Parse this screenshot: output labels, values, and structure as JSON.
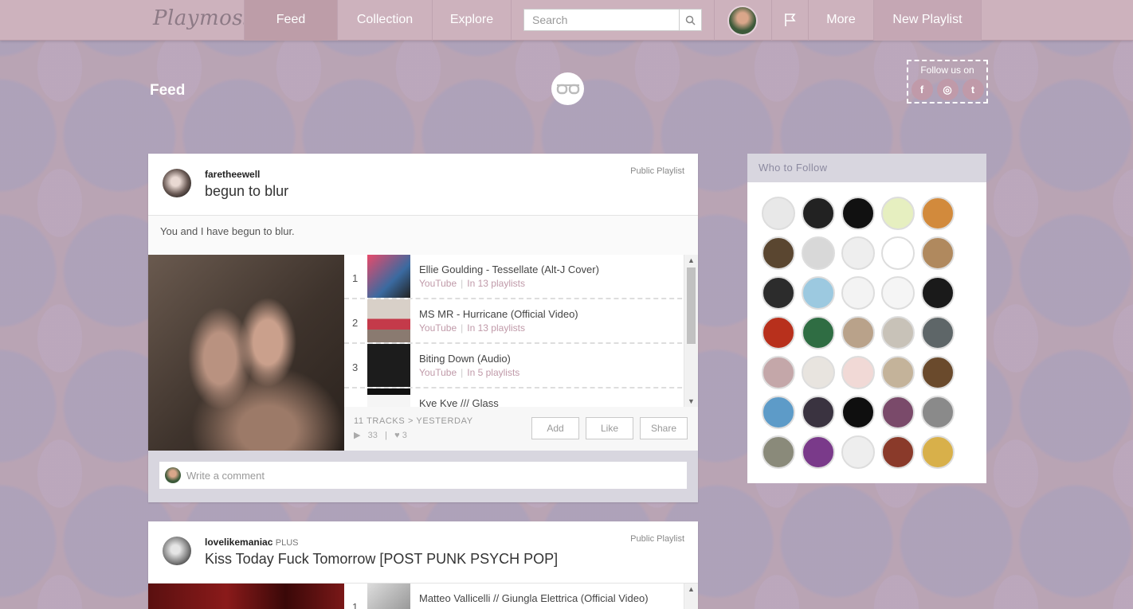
{
  "nav": {
    "logo": "Playmoss",
    "items": [
      "Feed",
      "Collection",
      "Explore"
    ],
    "search_placeholder": "Search",
    "more": "More",
    "new_playlist": "New Playlist"
  },
  "header": {
    "title": "Feed",
    "follow_label": "Follow us on",
    "socials": [
      "f",
      "◎",
      "t"
    ]
  },
  "posts": [
    {
      "username": "faretheewell",
      "badge": "",
      "visibility": "Public Playlist",
      "title": "begun to blur",
      "description": "You and I have begun to blur.",
      "tracks": [
        {
          "num": "1",
          "name": "Ellie Goulding - Tessellate (Alt-J Cover)",
          "source": "YouTube",
          "playlists": "In 13 playlists"
        },
        {
          "num": "2",
          "name": "MS MR - Hurricane (Official Video)",
          "source": "YouTube",
          "playlists": "In 13 playlists"
        },
        {
          "num": "3",
          "name": "Biting Down (Audio)",
          "source": "YouTube",
          "playlists": "In 5 playlists"
        },
        {
          "num": "",
          "name": "Kve Kve /// Glass",
          "source": "",
          "playlists": ""
        }
      ],
      "track_count": "11 TRACKS > YESTERDAY",
      "plays": "33",
      "likes": "3",
      "buttons": {
        "add": "Add",
        "like": "Like",
        "share": "Share"
      },
      "comment_placeholder": "Write a comment"
    },
    {
      "username": "lovelikemaniac",
      "badge": "PLUS",
      "visibility": "Public Playlist",
      "title": "Kiss Today Fuck Tomorrow [POST PUNK PSYCH POP]",
      "tracks": [
        {
          "num": "1",
          "name": "Matteo Vallicelli // Giungla Elettrica (Official Video)"
        }
      ]
    }
  ],
  "who_to_follow": {
    "title": "Who to Follow",
    "avatar_colors": [
      "#e8e8e8",
      "#222222",
      "#111111",
      "#e6efc0",
      "#d28a3c",
      "#5a4630",
      "#d8d8d8",
      "#eeeeee",
      "#ffffff",
      "#b0895e",
      "#2c2c2c",
      "#9cc9e0",
      "#f3f3f3",
      "#f5f5f5",
      "#1a1a1a",
      "#b8301c",
      "#2f6d43",
      "#b9a28a",
      "#c8c2b8",
      "#5e6668",
      "#c4a7a9",
      "#e8e4df",
      "#f1d9d6",
      "#c4b39a",
      "#6a4a2c",
      "#5d9bc8",
      "#3a3340",
      "#0f0f0f",
      "#7a4a6a",
      "#8a8a8a",
      "#8a8a7a",
      "#7a3a8a",
      "#eeeeee",
      "#8a3a2a",
      "#d8b04a"
    ]
  }
}
